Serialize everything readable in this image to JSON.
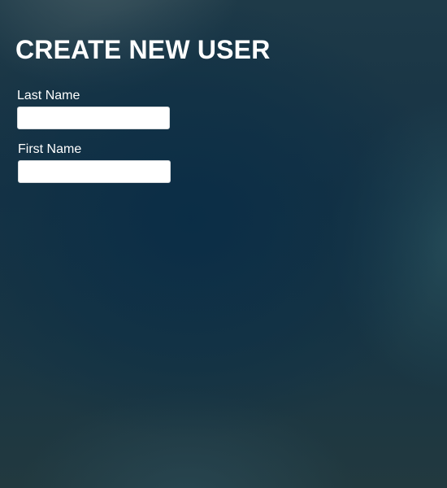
{
  "form": {
    "title": "CREATE NEW USER",
    "fields": [
      {
        "label": "Last Name",
        "value": "",
        "placeholder": ""
      },
      {
        "label": "First Name",
        "value": "",
        "placeholder": ""
      }
    ]
  },
  "colors": {
    "background": "#15303f",
    "text": "#ffffff",
    "input_background": "#ffffff"
  }
}
